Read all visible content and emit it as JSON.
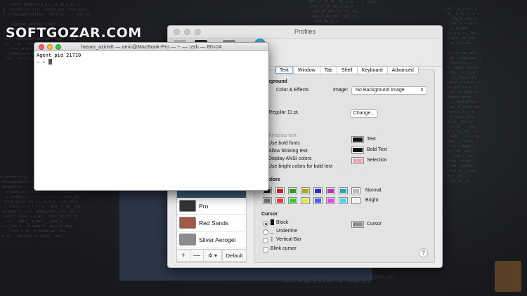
{
  "watermark": "SOFTGOZAR.COM",
  "profiles_window": {
    "title": "Profiles",
    "tabs": [
      "Text",
      "Window",
      "Tab",
      "Shell",
      "Keyboard",
      "Advanced"
    ],
    "active_tab": "Text",
    "sections": {
      "background": "Background",
      "font": "nt",
      "text": "xt",
      "ansi_colors": "SI Colors",
      "cursor": "Cursor"
    },
    "background_color_label": "Color & Effects",
    "image_label": "Image:",
    "image_value": "No Background Image",
    "font_value": "nio Regular 11 pt.",
    "change_button": "Change...",
    "text_options": [
      {
        "label": "Antialias text",
        "dim": true
      },
      {
        "label": "Use bold fonts",
        "dim": false
      },
      {
        "label": "Allow blinking text",
        "dim": false
      },
      {
        "label": "Display ANSI colors",
        "dim": false
      },
      {
        "label": "Use bright colors for bold text",
        "dim": false
      }
    ],
    "text_color_labels": [
      "Text",
      "Bold Text",
      "Selection"
    ],
    "text_color_values": [
      "#111111",
      "#111111",
      "#e8a6ad"
    ],
    "ansi_normal_label": "Normal",
    "ansi_bright_label": "Bright",
    "ansi_normal": [
      "#1a1a1a",
      "#c0272d",
      "#2a9a2a",
      "#a9a427",
      "#2533c8",
      "#b432b4",
      "#2aa3b5",
      "#bdbdbd"
    ],
    "ansi_bright": [
      "#6e6e6e",
      "#e63b3b",
      "#36c936",
      "#e8e23a",
      "#4b5cf0",
      "#e046e0",
      "#45d3e6",
      "#f2f2f2"
    ],
    "cursor_options": [
      "Block",
      "Underline",
      "Vertical Bar"
    ],
    "cursor_option_glyphs": [
      "█",
      "_",
      "|"
    ],
    "cursor_color_label": "Cursor",
    "cursor_color": "#8a8a8a",
    "blink_cursor_label": "Blink cursor",
    "help_label": "?",
    "profile_list": [
      "Pro",
      "Red Sands",
      "Silver Aerogel"
    ],
    "list_buttons": {
      "add": "+",
      "remove": "—",
      "gear": "✲ ▾",
      "default": "Default"
    }
  },
  "terminal_window": {
    "title": "hasan_azimi0 — amir@MacBook-Pro — ~ — -zsh — 80×24",
    "lines": [
      "Agent pid 21710",
      "~ ~ "
    ]
  }
}
